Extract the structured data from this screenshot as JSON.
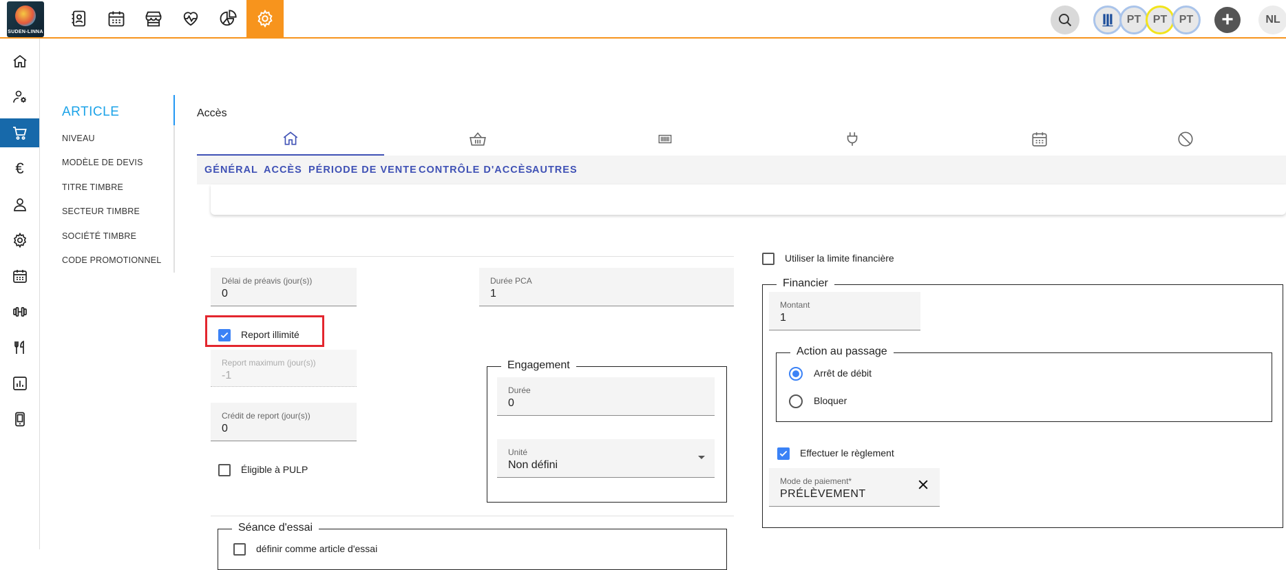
{
  "app": {
    "logo_text": "SUDEN-LINNA",
    "accent": "#f7941d",
    "primary": "#1769aa",
    "tab_color": "#3f51b5"
  },
  "topbar": {
    "nav_icons": [
      "contacts-icon",
      "calendar-icon",
      "shop-icon",
      "heartbeat-icon",
      "pie-chart-icon",
      "settings-icon"
    ],
    "avatars": [
      {
        "label": "",
        "icon": "heitz-logo-icon"
      },
      {
        "label": "PT"
      },
      {
        "label": "PT"
      },
      {
        "label": "PT"
      }
    ],
    "add_label": "+",
    "user_initials": "NL"
  },
  "sidebar": {
    "items": [
      "home-icon",
      "user-settings-icon",
      "cart-icon",
      "euro-icon",
      "person-icon",
      "gear-icon",
      "calendar-icon",
      "dumbbell-icon",
      "restaurant-icon",
      "chart-icon",
      "mobile-icon"
    ],
    "active_index": 2,
    "euro_glyph": "€"
  },
  "subnav": {
    "title": "ARTICLE",
    "items": [
      "NIVEAU",
      "MODÈLE DE DEVIS",
      "TITRE TIMBRE",
      "SECTEUR TIMBRE",
      "SOCIÉTÉ TIMBRE",
      "CODE PROMOTIONNEL"
    ]
  },
  "page": {
    "title": "Accès",
    "icon_tabs": [
      "home-icon",
      "basket-icon",
      "barcode-icon",
      "plug-icon",
      "calendar-icon",
      "block-icon"
    ],
    "text_tabs": [
      "GÉNÉRAL",
      "ACCÈS",
      "PÉRIODE DE VENTE",
      "CONTRÔLE D'ACCÈS",
      "AUTRES"
    ]
  },
  "form": {
    "preavis": {
      "label": "Délai de préavis (jour(s))",
      "value": "0"
    },
    "duree_pca": {
      "label": "Durée PCA",
      "value": "1"
    },
    "report_illimite": {
      "label": "Report illimité",
      "checked": true
    },
    "report_max": {
      "label": "Report maximum (jour(s))",
      "value": "-1"
    },
    "credit_report": {
      "label": "Crédit de report (jour(s))",
      "value": "0"
    },
    "eligible_pulp": {
      "label": "Éligible à PULP",
      "checked": false
    },
    "engagement": {
      "legend": "Engagement",
      "duree": {
        "label": "Durée",
        "value": "0"
      },
      "unite": {
        "label": "Unité",
        "value": "Non défini"
      }
    },
    "seance_essai": {
      "legend": "Séance d'essai",
      "option": "définir comme article d'essai"
    },
    "limite_financiere": {
      "label": "Utiliser la limite financière",
      "checked": false
    },
    "financier": {
      "legend": "Financier",
      "montant": {
        "label": "Montant",
        "value": "1"
      },
      "action": {
        "legend": "Action au passage",
        "options": [
          {
            "label": "Arrêt de débit",
            "checked": true
          },
          {
            "label": "Bloquer",
            "checked": false
          }
        ]
      },
      "effectuer_reglement": {
        "label": "Effectuer le règlement",
        "checked": true
      },
      "mode_paiement": {
        "label": "Mode de paiement*",
        "value": "PRÉLÈVEMENT"
      }
    }
  }
}
